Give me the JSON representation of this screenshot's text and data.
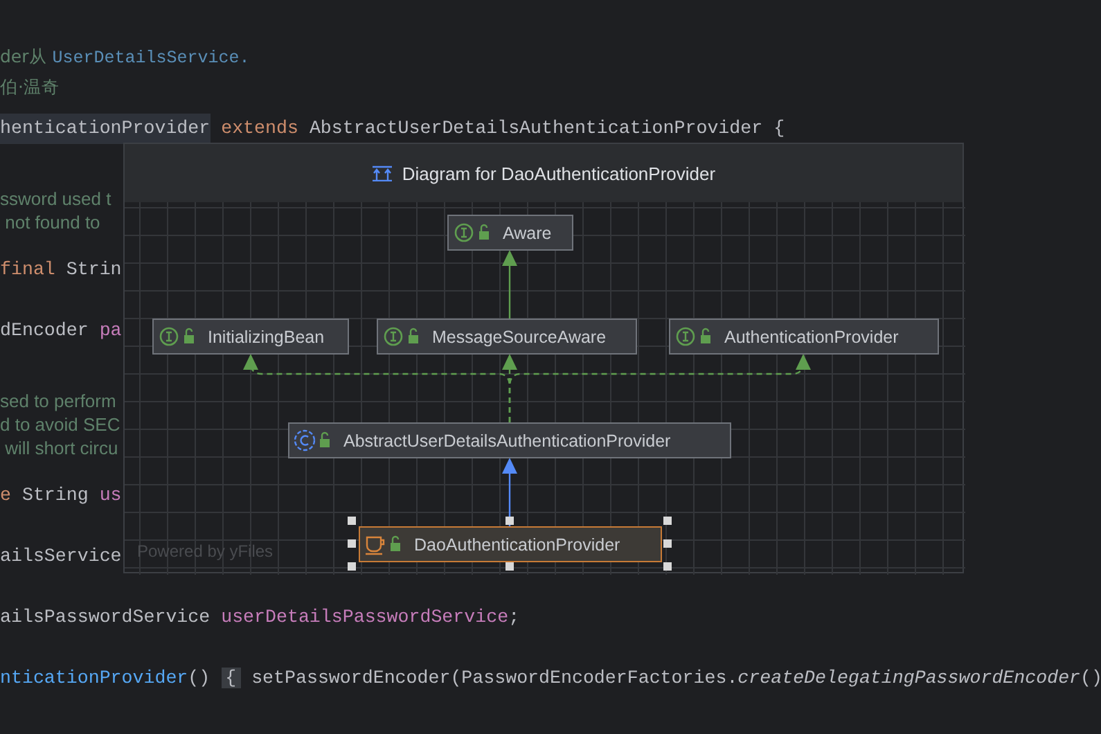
{
  "editor": {
    "lines": [
      {
        "kind": "doc",
        "segments": [
          {
            "kind": "comment",
            "text": "der从 "
          },
          {
            "kind": "ref",
            "text": "UserDetailsService."
          }
        ]
      },
      {
        "kind": "doc",
        "segments": [
          {
            "kind": "comment",
            "text": "伯·温奇"
          }
        ]
      },
      {
        "kind": "code",
        "current": true,
        "segments": [
          {
            "kind": "name",
            "text": "henticationProvider"
          },
          {
            "kind": "keyword",
            "text": " extends "
          },
          {
            "kind": "plain",
            "text": "AbstractUserDetailsAuthenticationProvider {"
          }
        ]
      },
      {
        "kind": "comment",
        "segments": [
          {
            "kind": "comment",
            "text": "ssword used t"
          }
        ]
      },
      {
        "kind": "comment",
        "segments": [
          {
            "kind": "comment",
            "text": " not found to"
          }
        ]
      },
      {
        "kind": "code",
        "segments": [
          {
            "kind": "keyword",
            "text": "final "
          },
          {
            "kind": "plain",
            "text": "Strin"
          }
        ]
      },
      {
        "kind": "code",
        "segments": [
          {
            "kind": "plain",
            "text": "dEncoder "
          },
          {
            "kind": "field",
            "text": "pa"
          }
        ]
      },
      {
        "kind": "comment",
        "segments": [
          {
            "kind": "comment",
            "text": "sed to perform"
          }
        ]
      },
      {
        "kind": "comment",
        "segments": [
          {
            "kind": "comment",
            "text": "d to avoid SEC"
          }
        ]
      },
      {
        "kind": "comment",
        "segments": [
          {
            "kind": "comment",
            "text": " will short circu"
          }
        ]
      },
      {
        "kind": "code",
        "segments": [
          {
            "kind": "keyword",
            "text": "e "
          },
          {
            "kind": "plain",
            "text": "String "
          },
          {
            "kind": "field",
            "text": "us"
          }
        ]
      },
      {
        "kind": "code",
        "segments": [
          {
            "kind": "plain",
            "text": "ailsService"
          }
        ]
      },
      {
        "kind": "code",
        "segments": [
          {
            "kind": "plain",
            "text": "ailsPasswordService "
          },
          {
            "kind": "field",
            "text": "userDetailsPasswordService"
          },
          {
            "kind": "plain",
            "text": ";"
          }
        ]
      },
      {
        "kind": "code",
        "segments": [
          {
            "kind": "method",
            "text": "nticationProvider"
          },
          {
            "kind": "plain",
            "text": "() "
          },
          {
            "kind": "fold",
            "text": "{"
          },
          {
            "kind": "plain",
            "text": " setPasswordEncoder(PasswordEncoderFactories."
          },
          {
            "kind": "italic",
            "text": "createDelegatingPasswordEncoder"
          },
          {
            "kind": "plain",
            "text": "()"
          }
        ]
      }
    ]
  },
  "diagram": {
    "title": "Diagram for DaoAuthenticationProvider",
    "nodes": [
      {
        "name": "Aware",
        "kind": "interface",
        "selected": false
      },
      {
        "name": "InitializingBean",
        "kind": "interface",
        "selected": false
      },
      {
        "name": "MessageSourceAware",
        "kind": "interface",
        "selected": false
      },
      {
        "name": "AuthenticationProvider",
        "kind": "interface",
        "selected": false
      },
      {
        "name": "AbstractUserDetailsAuthenticationProvider",
        "kind": "abstract_class",
        "selected": false
      },
      {
        "name": "DaoAuthenticationProvider",
        "kind": "class",
        "selected": true
      }
    ],
    "footer": "Powered by yFiles"
  }
}
